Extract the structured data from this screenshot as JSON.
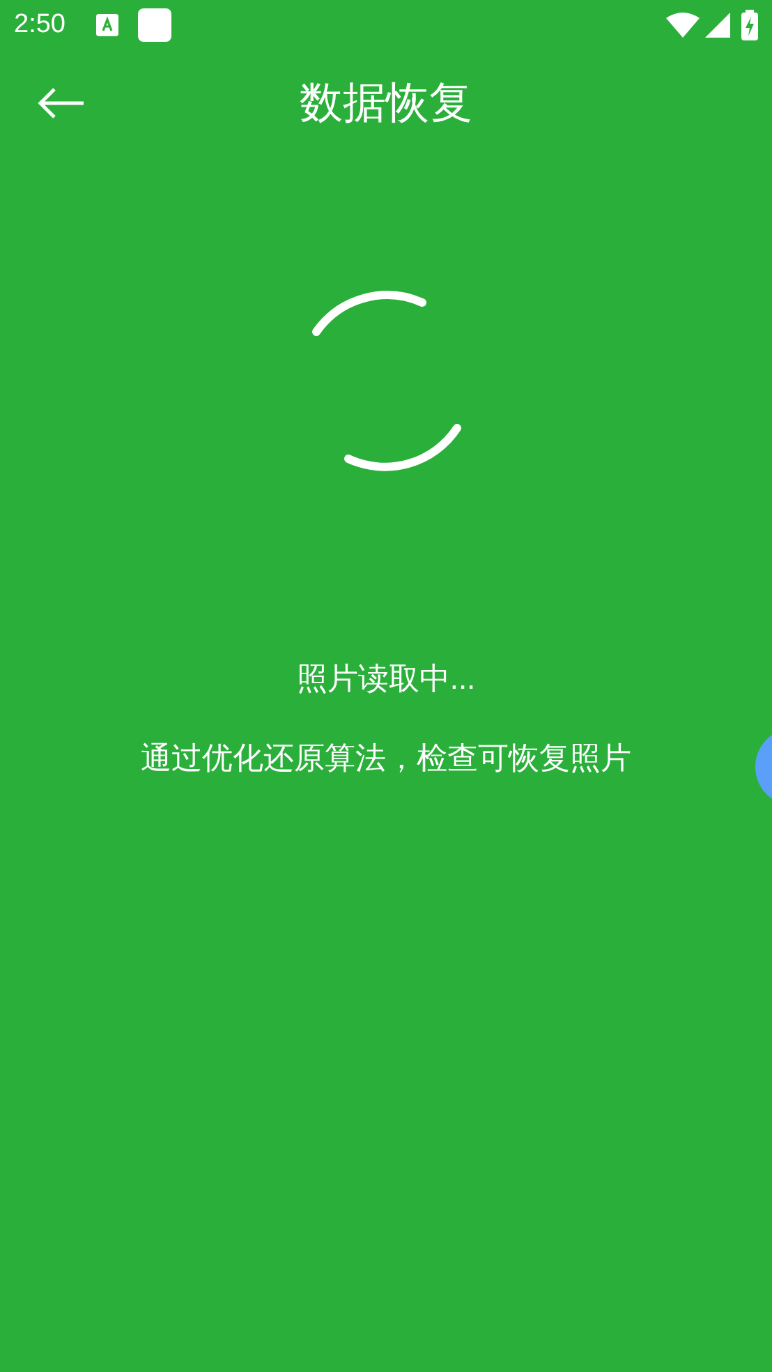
{
  "status_bar": {
    "time": "2:50"
  },
  "header": {
    "title": "数据恢复"
  },
  "progress": {
    "status": "照片读取中...",
    "description": "通过优化还原算法，检查可恢复照片"
  }
}
